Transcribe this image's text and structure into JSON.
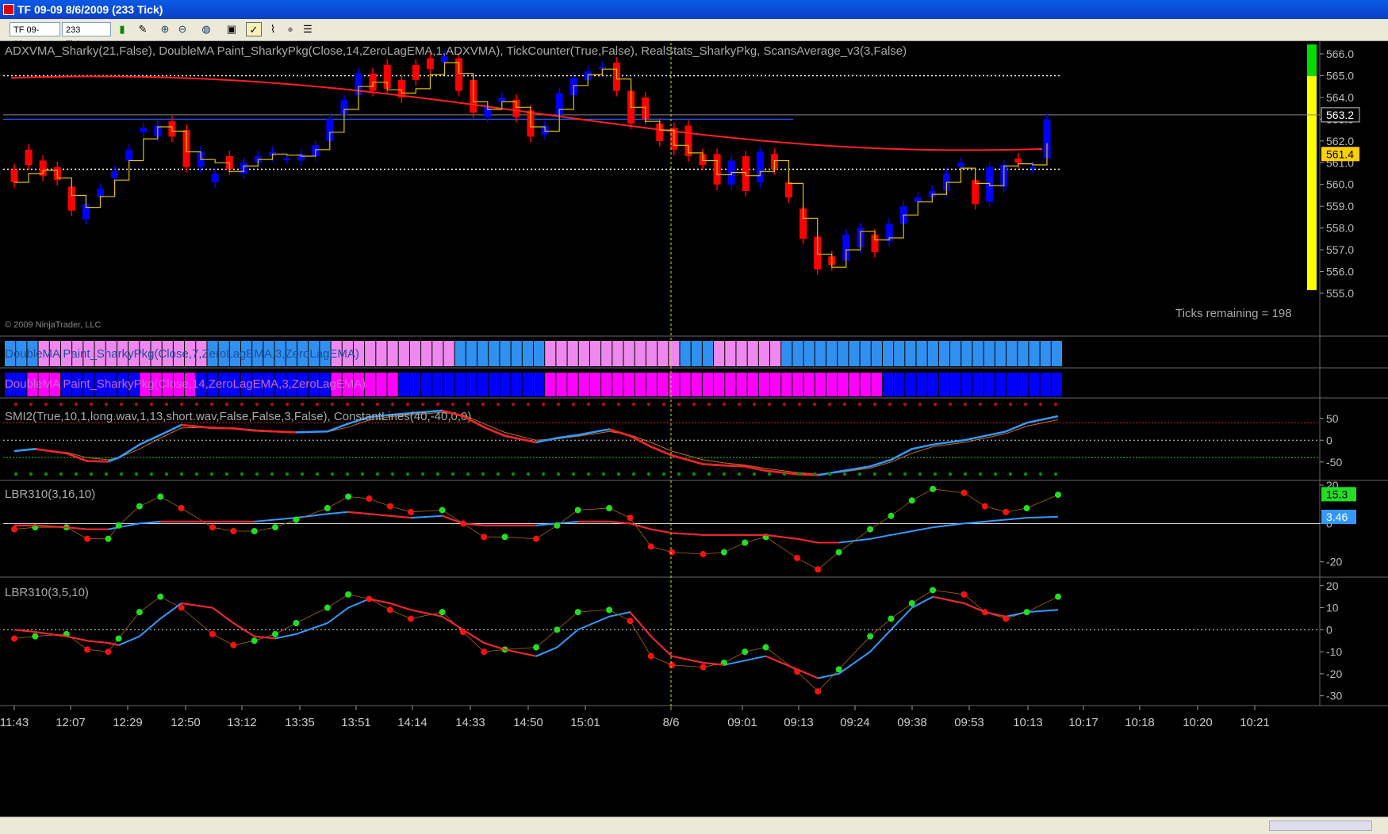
{
  "window": {
    "title": "TF 09-09  8/6/2009 (233 Tick)"
  },
  "toolbar": {
    "instrument": "TF 09-09",
    "interval": "233 Tick",
    "icons": [
      "bar-type-icon",
      "draw-pencil-icon",
      "zoom-in-icon",
      "zoom-out-icon",
      "globe-icon",
      "data-box-icon",
      "indicators-icon",
      "strategies-icon",
      "circle-icon",
      "properties-icon"
    ]
  },
  "chart": {
    "copyright": "© 2009 NinjaTrader, LLC",
    "ticks_remaining": "Ticks remaining = 198",
    "panels": [
      {
        "id": "price",
        "label": "ADXVMA_Sharky(21,False),  DoubleMA  Paint_SharkyPkg(Close,14,ZeroLagEMA,1,ADXVMA),  TickCounter(True,False),  RealStats_SharkyPkg,  ScansAverage_v3(3,False)",
        "y_ticks": [
          "566.0",
          "565.0",
          "564.0",
          "563.0",
          "562.0",
          "561.0",
          "560.0",
          "559.0",
          "558.0",
          "557.0",
          "556.0",
          "555.0"
        ],
        "last_price": "563.2",
        "marker_price": "561.4"
      },
      {
        "id": "ma1",
        "label": "DoubleMA  Paint_SharkyPkg(Close,7,ZeroLagEMA,3,ZeroLagEMA)"
      },
      {
        "id": "ma2",
        "label": "DoubleMA Paint_SharkyPkg(Close,14,ZeroLagEMA,3,ZeroLagEMA)"
      },
      {
        "id": "smi",
        "label": "SMI2(True,10,1,long.wav,1,13,short.wav,False,False,3,False),  ConstantLines(40,-40,0,0)",
        "y_ticks": [
          "50",
          "0",
          "-50"
        ]
      },
      {
        "id": "lbr1",
        "label": "LBR310(3,16,10)",
        "y_ticks": [
          "20",
          "0",
          "-20"
        ],
        "badge_fast": "15.3",
        "badge_slow": "3.46"
      },
      {
        "id": "lbr2",
        "label": "LBR310(3,5,10)",
        "y_ticks": [
          "20",
          "10",
          "0",
          "-10",
          "-20",
          "-30"
        ]
      }
    ],
    "x_ticks": [
      "11:43",
      "12:07",
      "12:29",
      "12:50",
      "13:12",
      "13:35",
      "13:51",
      "14:14",
      "14:33",
      "14:50",
      "15:01",
      "8/6",
      "09:01",
      "09:13",
      "09:24",
      "09:38",
      "09:53",
      "10:13",
      "10:17",
      "10:18",
      "10:20",
      "10:21"
    ]
  },
  "chart_data": [
    {
      "type": "candlestick",
      "series_note": "price",
      "ylim": [
        555.0,
        566.0
      ],
      "closes": [
        560.1,
        560.9,
        560.4,
        560.2,
        558.8,
        559.1,
        559.8,
        560.6,
        561.6,
        562.6,
        562.7,
        562.2,
        560.8,
        561.5,
        560.5,
        560.7,
        561.0,
        561.3,
        561.5,
        561.2,
        561.4,
        561.8,
        563.0,
        563.9,
        565.1,
        564.3,
        564.4,
        564.0,
        564.8,
        565.3,
        565.9,
        564.3,
        563.3,
        563.6,
        564.0,
        563.1,
        562.2,
        562.7,
        564.2,
        564.9,
        565.2,
        565.4,
        564.3,
        562.8,
        563.0,
        562.0,
        561.6,
        561.3,
        560.9,
        560.0,
        561.1,
        559.7,
        561.5,
        560.7,
        559.4,
        557.5,
        556.1,
        556.3,
        557.7,
        558.0,
        556.9,
        558.2,
        559.0,
        559.4,
        559.7,
        560.5,
        561.0,
        559.1,
        560.8,
        560.9,
        561.0,
        560.8,
        563.0
      ],
      "opens": [
        560.7,
        561.6,
        561.1,
        560.8,
        559.9,
        558.4,
        559.4,
        560.3,
        561.1,
        562.4,
        562.2,
        562.9,
        562.5,
        560.8,
        560.1,
        561.3,
        560.5,
        561.0,
        561.3,
        561.2,
        561.1,
        561.3,
        562.0,
        563.2,
        564.1,
        565.1,
        565.5,
        564.8,
        565.5,
        565.8,
        565.6,
        565.8,
        564.8,
        563.1,
        563.8,
        563.9,
        563.4,
        562.3,
        563.2,
        564.1,
        564.8,
        565.3,
        565.6,
        564.3,
        564.0,
        562.8,
        562.6,
        562.7,
        561.4,
        561.4,
        560.0,
        561.3,
        560.1,
        561.4,
        560.1,
        558.9,
        557.6,
        556.7,
        556.5,
        557.1,
        557.7,
        557.4,
        558.2,
        559.2,
        559.4,
        559.7,
        560.8,
        560.2,
        559.2,
        559.9,
        561.2,
        560.8,
        561.2
      ],
      "ma_red_start": 564.9,
      "ma_red_end": 561.7,
      "ma_blue": 563.0,
      "step_line_start": 561.0,
      "step_line_end": 561.4,
      "dotted_lines": [
        565.0,
        560.7
      ]
    },
    {
      "type": "heatmap",
      "series_note": "ma1_colors",
      "categories": [
        "blue",
        "blue",
        "blue",
        "pink",
        "pink",
        "pink",
        "pink",
        "pink",
        "pink",
        "pink",
        "pink",
        "pink",
        "pink",
        "pink",
        "pink",
        "pink",
        "pink",
        "pink",
        "blue",
        "blue",
        "blue",
        "blue",
        "blue",
        "blue",
        "blue",
        "blue",
        "blue",
        "blue",
        "blue",
        "pink",
        "pink",
        "pink",
        "pink",
        "pink",
        "pink",
        "pink",
        "pink",
        "pink",
        "pink",
        "pink",
        "blue",
        "blue",
        "blue",
        "blue",
        "blue",
        "blue",
        "blue",
        "blue",
        "pink",
        "pink",
        "pink",
        "pink",
        "pink",
        "pink",
        "pink",
        "pink",
        "pink",
        "pink",
        "pink",
        "pink",
        "blue",
        "blue",
        "blue",
        "pink",
        "pink",
        "pink",
        "pink",
        "pink",
        "pink",
        "blue",
        "blue",
        "blue",
        "blue",
        "blue",
        "blue",
        "blue",
        "blue",
        "blue",
        "blue",
        "blue",
        "blue",
        "blue",
        "blue",
        "blue",
        "blue",
        "blue",
        "blue",
        "blue",
        "blue",
        "blue",
        "blue",
        "blue",
        "blue",
        "blue"
      ]
    },
    {
      "type": "heatmap",
      "series_note": "ma2_colors",
      "categories": [
        "blue",
        "blue",
        "magenta",
        "magenta",
        "magenta",
        "blue",
        "blue",
        "blue",
        "blue",
        "blue",
        "blue",
        "blue",
        "magenta",
        "magenta",
        "magenta",
        "magenta",
        "magenta",
        "blue",
        "blue",
        "blue",
        "blue",
        "blue",
        "blue",
        "blue",
        "blue",
        "blue",
        "blue",
        "blue",
        "blue",
        "magenta",
        "magenta",
        "magenta",
        "magenta",
        "magenta",
        "magenta",
        "blue",
        "blue",
        "blue",
        "blue",
        "blue",
        "blue",
        "blue",
        "blue",
        "blue",
        "blue",
        "blue",
        "blue",
        "blue",
        "magenta",
        "magenta",
        "magenta",
        "magenta",
        "magenta",
        "magenta",
        "magenta",
        "magenta",
        "magenta",
        "magenta",
        "magenta",
        "magenta",
        "magenta",
        "magenta",
        "magenta",
        "magenta",
        "magenta",
        "magenta",
        "magenta",
        "magenta",
        "magenta",
        "magenta",
        "magenta",
        "magenta",
        "magenta",
        "magenta",
        "magenta",
        "magenta",
        "magenta",
        "magenta",
        "blue",
        "blue",
        "blue",
        "blue",
        "blue",
        "blue",
        "blue",
        "blue",
        "blue",
        "blue",
        "blue",
        "blue",
        "blue",
        "blue",
        "blue",
        "blue"
      ]
    },
    {
      "type": "line",
      "series_note": "smi",
      "ylim": [
        -85,
        75
      ],
      "x": [
        0,
        0.02,
        0.05,
        0.07,
        0.09,
        0.1,
        0.12,
        0.14,
        0.16,
        0.19,
        0.21,
        0.23,
        0.25,
        0.27,
        0.3,
        0.32,
        0.34,
        0.36,
        0.38,
        0.41,
        0.43,
        0.45,
        0.47,
        0.5,
        0.52,
        0.54,
        0.57,
        0.59,
        0.61,
        0.63,
        0.66,
        0.68,
        0.7,
        0.72,
        0.75,
        0.77,
        0.79,
        0.82,
        0.84,
        0.86,
        0.88,
        0.91,
        0.93,
        0.95,
        0.97,
        1.0
      ],
      "fast": [
        -25,
        -20,
        -30,
        -48,
        -49,
        -40,
        -10,
        12,
        35,
        28,
        27,
        22,
        20,
        18,
        20,
        38,
        53,
        58,
        62,
        68,
        55,
        30,
        10,
        -5,
        5,
        12,
        25,
        10,
        -15,
        -35,
        -55,
        -58,
        -60,
        -70,
        -78,
        -80,
        -72,
        -60,
        -45,
        -20,
        -10,
        0,
        10,
        20,
        40,
        55
      ],
      "slow": [
        -24,
        -22,
        -28,
        -40,
        -45,
        -40,
        -20,
        5,
        28,
        30,
        28,
        24,
        21,
        19,
        19,
        30,
        46,
        54,
        58,
        64,
        58,
        38,
        18,
        0,
        3,
        9,
        20,
        12,
        -5,
        -25,
        -45,
        -52,
        -57,
        -65,
        -74,
        -78,
        -74,
        -64,
        -50,
        -30,
        -15,
        -5,
        5,
        15,
        32,
        47
      ],
      "constant_lines": [
        40,
        -40,
        0
      ]
    },
    {
      "type": "line",
      "series_note": "lbr_3_16_10",
      "ylim": [
        -28,
        20
      ],
      "x": [
        0,
        0.02,
        0.05,
        0.07,
        0.09,
        0.1,
        0.12,
        0.14,
        0.16,
        0.19,
        0.21,
        0.23,
        0.25,
        0.27,
        0.3,
        0.32,
        0.34,
        0.36,
        0.38,
        0.41,
        0.43,
        0.45,
        0.47,
        0.5,
        0.52,
        0.54,
        0.57,
        0.59,
        0.61,
        0.63,
        0.66,
        0.68,
        0.7,
        0.72,
        0.75,
        0.77,
        0.79,
        0.82,
        0.84,
        0.86,
        0.88,
        0.91,
        0.93,
        0.95,
        0.97,
        1.0
      ],
      "fast": [
        -3,
        -2,
        -2,
        -8,
        -8,
        -1,
        9,
        14,
        8,
        -2,
        -4,
        -4,
        -2,
        2,
        8,
        14,
        13,
        9,
        6,
        7,
        0,
        -7,
        -7,
        -8,
        -1,
        7,
        8,
        3,
        -12,
        -15,
        -16,
        -15,
        -10,
        -7,
        -18,
        -24,
        -15,
        -3,
        4,
        12,
        18,
        16,
        9,
        6,
        8,
        15
      ],
      "slow": [
        -1,
        -1,
        -2,
        -3,
        -3,
        -2,
        0,
        1,
        1,
        1,
        1,
        1,
        2,
        3,
        5,
        6,
        5,
        4,
        3,
        4,
        0,
        -1,
        -1,
        -1,
        0,
        1,
        1,
        0,
        -3,
        -5,
        -6,
        -6,
        -6,
        -6,
        -8,
        -10,
        -10,
        -8,
        -6,
        -4,
        -2,
        0,
        1,
        2,
        3,
        3.5
      ]
    },
    {
      "type": "line",
      "series_note": "lbr_3_5_10",
      "ylim": [
        -33,
        21
      ],
      "x": [
        0,
        0.02,
        0.05,
        0.07,
        0.09,
        0.1,
        0.12,
        0.14,
        0.16,
        0.19,
        0.21,
        0.23,
        0.25,
        0.27,
        0.3,
        0.32,
        0.34,
        0.36,
        0.38,
        0.41,
        0.43,
        0.45,
        0.47,
        0.5,
        0.52,
        0.54,
        0.57,
        0.59,
        0.61,
        0.63,
        0.66,
        0.68,
        0.7,
        0.72,
        0.75,
        0.77,
        0.79,
        0.82,
        0.84,
        0.86,
        0.88,
        0.91,
        0.93,
        0.95,
        0.97,
        1.0
      ],
      "fast": [
        -4,
        -3,
        -2,
        -9,
        -10,
        -4,
        8,
        15,
        10,
        -2,
        -7,
        -5,
        -2,
        3,
        10,
        16,
        14,
        9,
        5,
        8,
        -1,
        -10,
        -9,
        -8,
        0,
        8,
        9,
        4,
        -12,
        -16,
        -17,
        -15,
        -10,
        -8,
        -19,
        -28,
        -18,
        -3,
        5,
        12,
        18,
        16,
        8,
        5,
        8,
        15
      ],
      "slow": [
        0,
        -1,
        -3,
        -5,
        -6,
        -7,
        -3,
        5,
        12,
        10,
        3,
        -3,
        -4,
        -2,
        3,
        10,
        14,
        12,
        9,
        6,
        0,
        -6,
        -9,
        -12,
        -8,
        0,
        6,
        8,
        -3,
        -12,
        -15,
        -16,
        -14,
        -12,
        -18,
        -22,
        -20,
        -10,
        0,
        10,
        15,
        12,
        8,
        6,
        8,
        9
      ]
    }
  ]
}
